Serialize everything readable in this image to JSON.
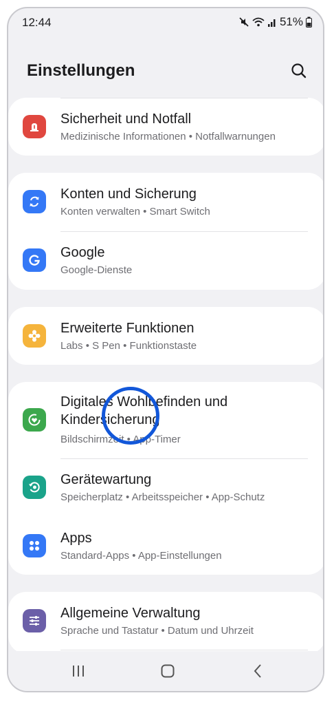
{
  "status": {
    "time": "12:44",
    "battery": "51%"
  },
  "header": {
    "title": "Einstellungen"
  },
  "items": [
    {
      "title": "Sicherheit und Notfall",
      "subtitle": "Medizinische Informationen • Notfallwarnungen",
      "icon": "emergency-icon",
      "color": "#e0473f"
    },
    {
      "title": "Konten und Sicherung",
      "subtitle": "Konten verwalten • Smart Switch",
      "icon": "sync-icon",
      "color": "#3478f6"
    },
    {
      "title": "Google",
      "subtitle": "Google-Dienste",
      "icon": "google-icon",
      "color": "#3478f6"
    },
    {
      "title": "Erweiterte Funktionen",
      "subtitle": "Labs • S Pen • Funktionstaste",
      "icon": "advanced-features-icon",
      "color": "#f5b43c"
    },
    {
      "title": "Digitales Wohlbefinden und Kindersicherung",
      "subtitle": "Bildschirmzeit • App-Timer",
      "icon": "wellbeing-icon",
      "color": "#3ca84d"
    },
    {
      "title": "Gerätewartung",
      "subtitle": "Speicherplatz • Arbeitsspeicher • App-Schutz",
      "icon": "device-care-icon",
      "color": "#1aa38a"
    },
    {
      "title": "Apps",
      "subtitle": "Standard-Apps • App-Einstellungen",
      "icon": "apps-icon",
      "color": "#3478f6"
    },
    {
      "title": "Allgemeine Verwaltung",
      "subtitle": "Sprache und Tastatur • Datum und Uhrzeit",
      "icon": "general-management-icon",
      "color": "#6b5fa8"
    }
  ]
}
